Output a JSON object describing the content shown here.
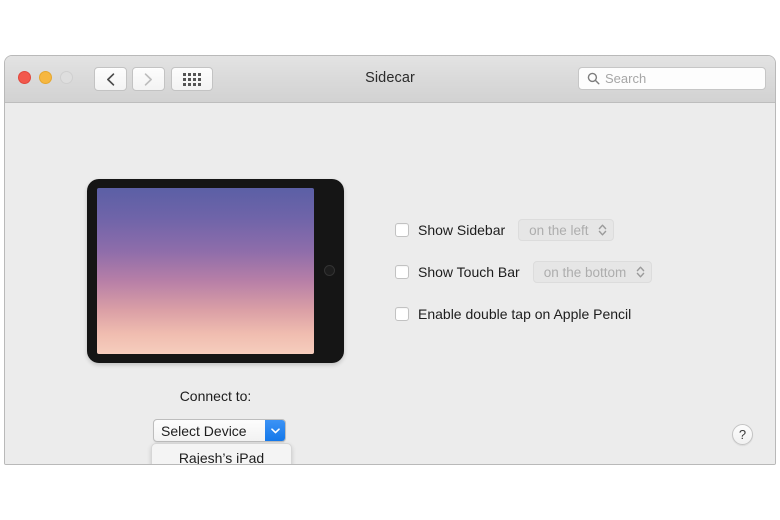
{
  "window": {
    "title": "Sidecar",
    "traffic_lights": [
      {
        "name": "close",
        "color": "#f2584c"
      },
      {
        "name": "minimize",
        "color": "#f6b740"
      },
      {
        "name": "zoom",
        "color": "#dedede"
      }
    ],
    "toolbar": {
      "back_icon": "chevron-left-icon",
      "forward_icon": "chevron-right-icon",
      "show-all_icon": "grid-icon"
    },
    "search": {
      "icon": "search-icon",
      "value": "",
      "placeholder": "Search"
    }
  },
  "device_preview": {
    "device": "iPad",
    "home_button": "home-button"
  },
  "connect": {
    "label": "Connect to:",
    "popup_value": "Select Device",
    "chevron_icon": "chevron-down-icon",
    "accent_color": "#1478ea",
    "menu_open": true,
    "menu_items": [
      {
        "label": "Rajesh’s iPad"
      }
    ]
  },
  "options": [
    {
      "id": "show-sidebar",
      "label": "Show Sidebar",
      "checked": false,
      "popup_value": "on the left",
      "popup_enabled": false,
      "popup_icon": "stepper-chevrons-icon"
    },
    {
      "id": "show-touch-bar",
      "label": "Show Touch Bar",
      "checked": false,
      "popup_value": "on the bottom",
      "popup_enabled": false,
      "popup_icon": "stepper-chevrons-icon"
    },
    {
      "id": "enable-double-tap",
      "label": "Enable double tap on Apple Pencil",
      "checked": false
    }
  ],
  "help": {
    "label": "?"
  }
}
